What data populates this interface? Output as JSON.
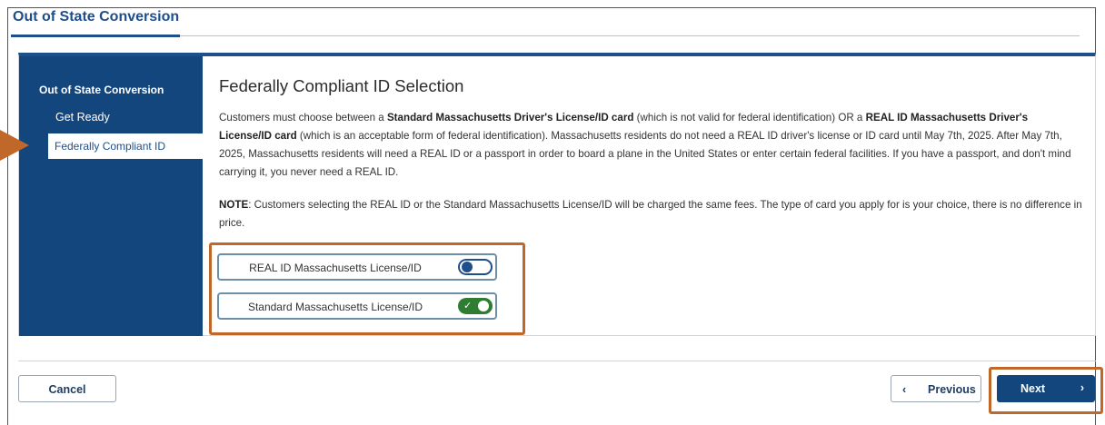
{
  "page": {
    "title": "Out of State Conversion"
  },
  "sidebar": {
    "heading": "Out of State Conversion",
    "items": [
      {
        "label": "Get Ready"
      },
      {
        "label": "Federally Compliant ID"
      }
    ]
  },
  "main": {
    "heading": "Federally Compliant ID Selection",
    "intro": {
      "t1": "Customers must choose between a ",
      "b1": "Standard Massachusetts Driver's License/ID card",
      "t2": " (which is not valid for federal identification) OR a ",
      "b2": "REAL ID Massachusetts Driver's License/ID card",
      "t3": " (which is an acceptable form of federal identification). Massachusetts residents do not need a REAL ID driver's license or ID card until May 7th, 2025. After May 7th, 2025, Massachusetts residents will need a REAL ID or a passport in order to board a plane in the United States or enter certain federal facilities. If you have a passport, and don't mind carrying it, you never need a REAL ID."
    },
    "note": {
      "label": "NOTE",
      "text": ": Customers selecting the REAL ID or the Standard Massachusetts License/ID will be charged the same fees. The type of card you apply for is your choice, there is no difference in price."
    },
    "options": [
      {
        "label": "REAL ID Massachusetts License/ID",
        "checked": false
      },
      {
        "label": "Standard Massachusetts License/ID",
        "checked": true
      }
    ]
  },
  "footer": {
    "cancel_label": "Cancel",
    "previous_label": "Previous",
    "next_label": "Next"
  },
  "icons": {
    "previous": "chevron-left-icon",
    "next": "chevron-right-icon",
    "callout": "arrow-right-icon",
    "check": "checkmark-icon"
  },
  "colors": {
    "brand_blue": "#14467e",
    "highlight_orange": "#c0672a",
    "toggle_on": "#2e7d32"
  }
}
